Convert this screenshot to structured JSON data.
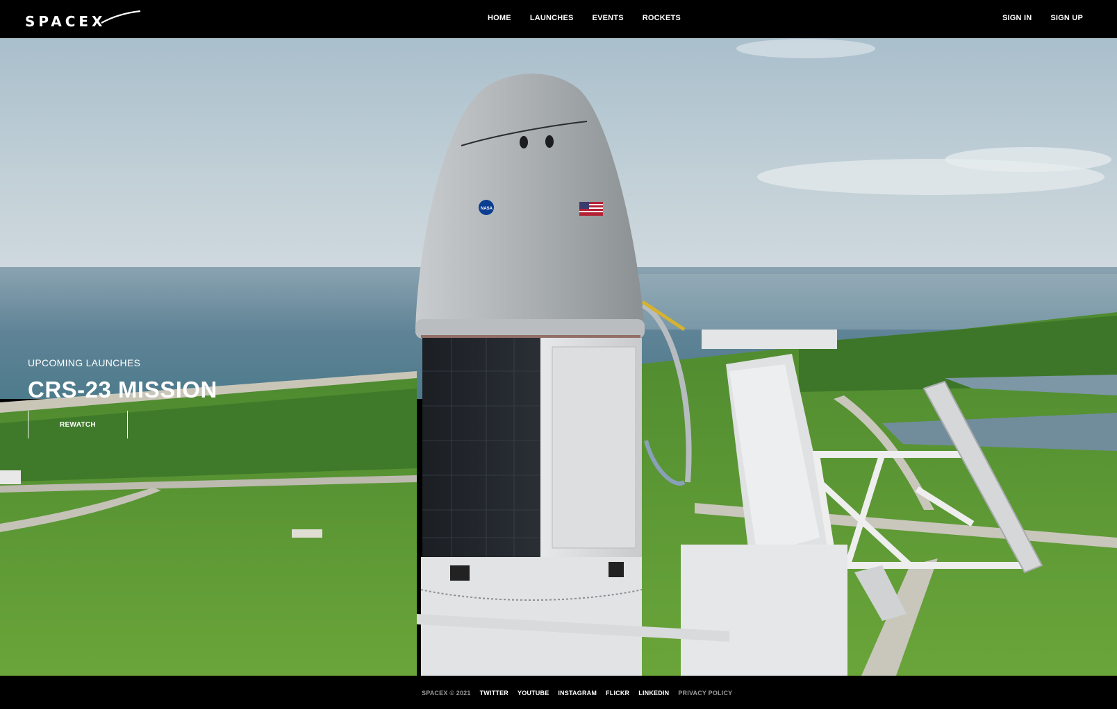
{
  "header": {
    "logo_text": "SPACEX",
    "nav": [
      {
        "label": "HOME"
      },
      {
        "label": "LAUNCHES"
      },
      {
        "label": "EVENTS"
      },
      {
        "label": "ROCKETS"
      }
    ],
    "auth": {
      "sign_in": "SIGN IN",
      "sign_up": "SIGN UP"
    }
  },
  "hero": {
    "subtitle": "UPCOMING LAUNCHES",
    "title": "CRS-23 MISSION",
    "button_label": "REWATCH",
    "scroll_icon": "chevron-down-icon",
    "flag_text": "NASA"
  },
  "footer": {
    "copyright": "SPACEX © 2021",
    "links": [
      {
        "label": "TWITTER"
      },
      {
        "label": "YOUTUBE"
      },
      {
        "label": "INSTAGRAM"
      },
      {
        "label": "FLICKR"
      },
      {
        "label": "LINKEDIN"
      },
      {
        "label": "PRIVACY POLICY"
      }
    ]
  },
  "colors": {
    "background": "#000000",
    "text": "#ffffff",
    "muted": "#9a9a9a"
  }
}
